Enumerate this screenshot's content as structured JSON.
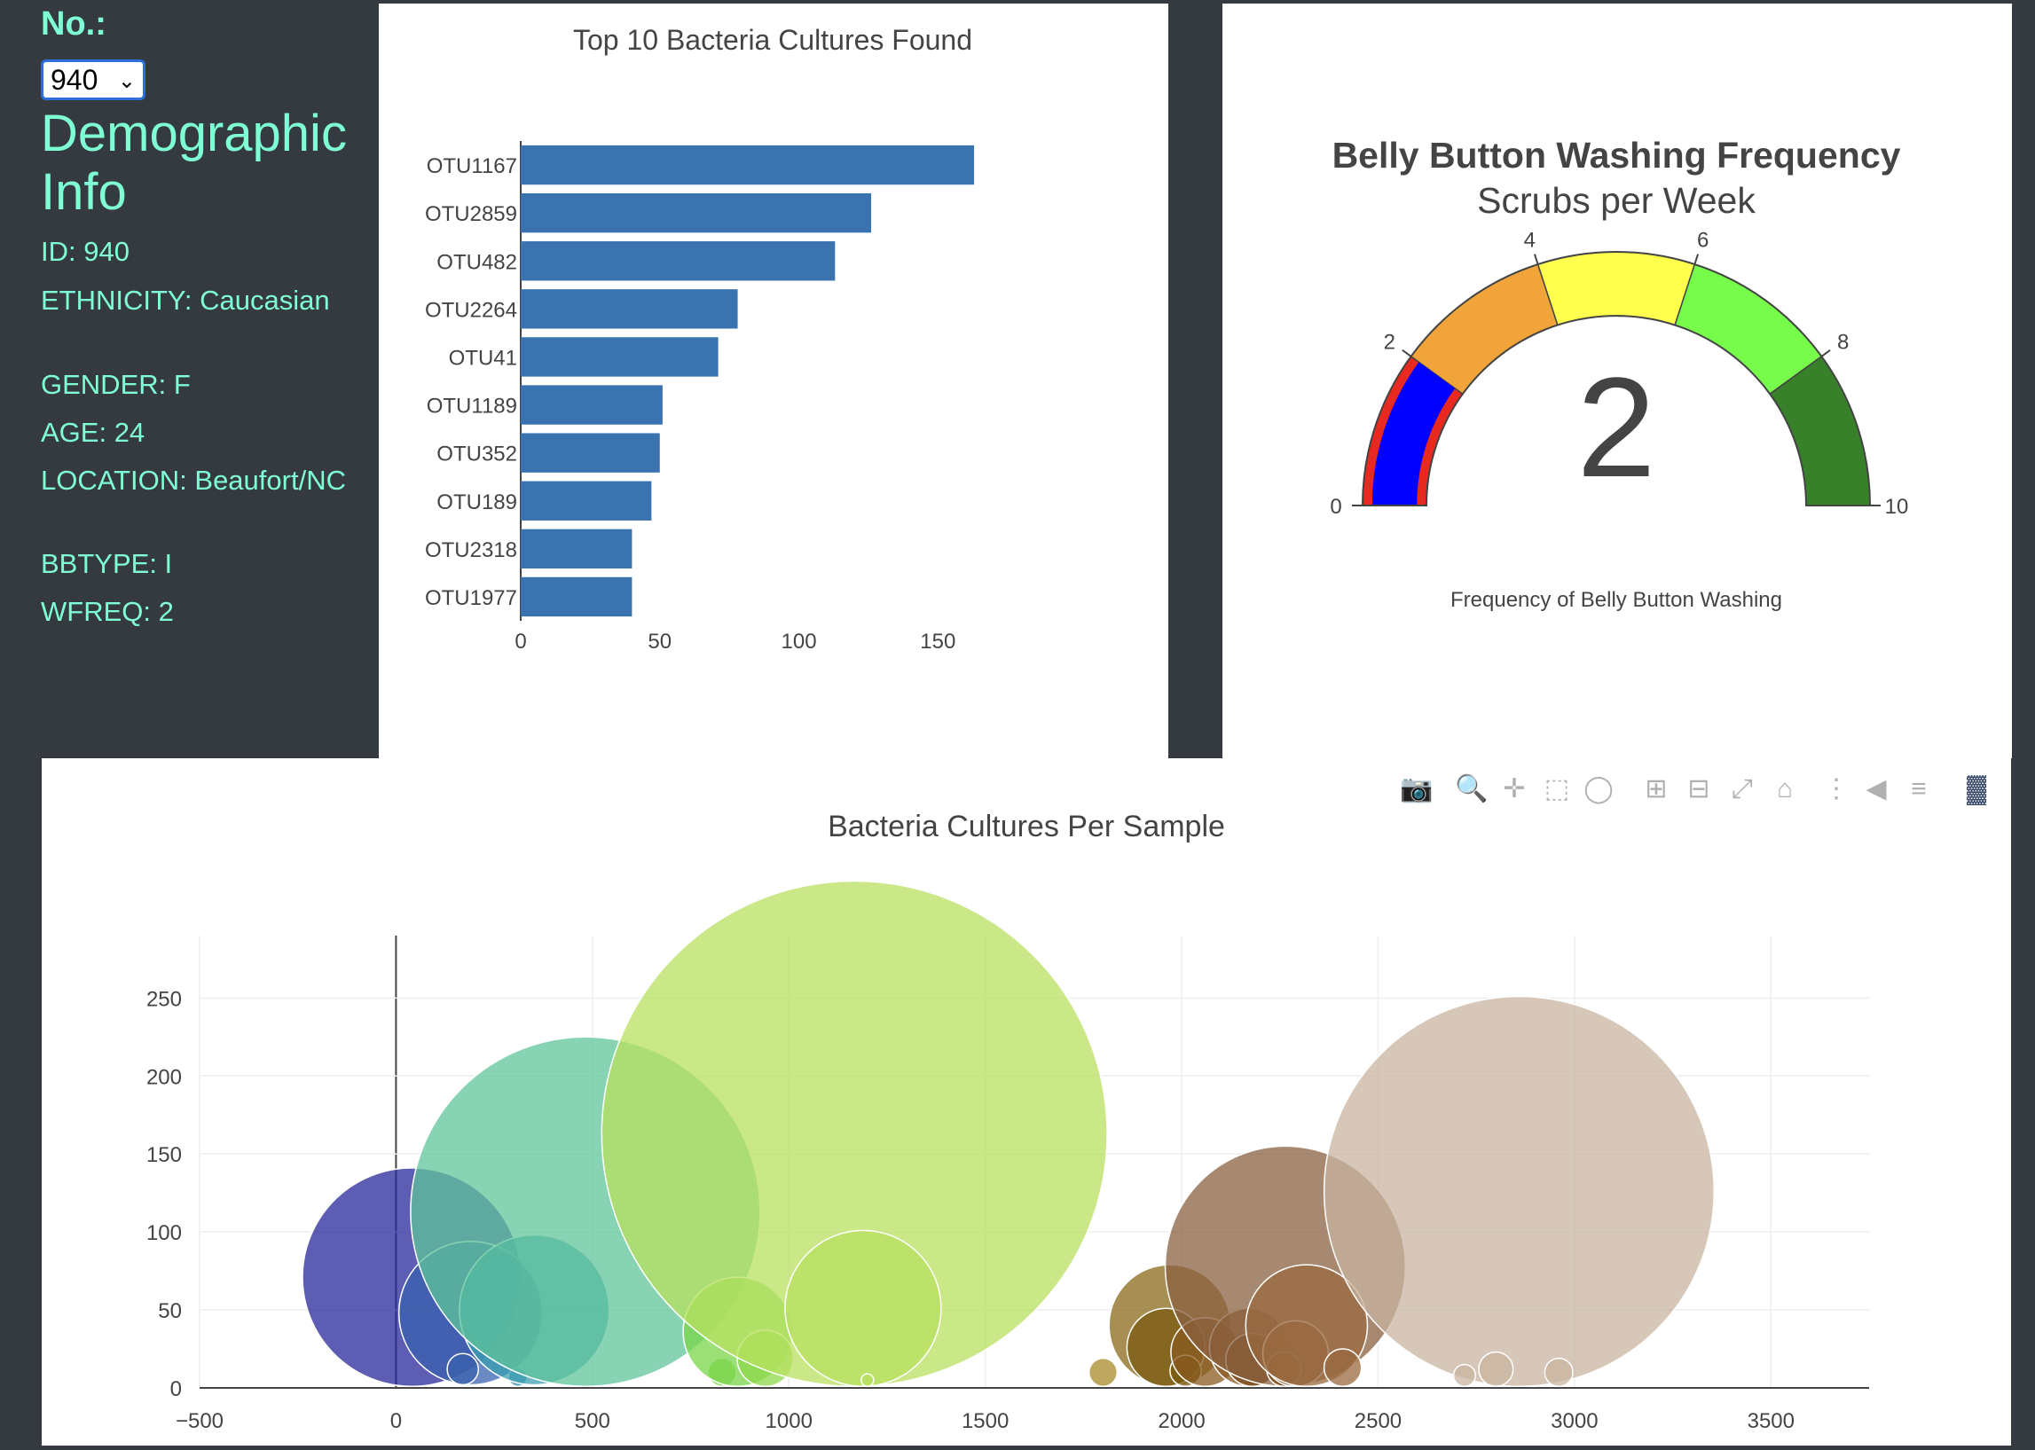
{
  "sidebar": {
    "no_label": "No.:",
    "selected_id": "940",
    "title": "Demographic Info",
    "info": [
      {
        "text": "ID: 940"
      },
      {
        "text": "ETHNICITY: Caucasian"
      },
      {
        "text": "GENDER: F"
      },
      {
        "text": "AGE: 24"
      },
      {
        "text": "LOCATION: Beaufort/NC"
      },
      {
        "text": "BBTYPE: I"
      },
      {
        "text": "WFREQ: 2"
      }
    ]
  },
  "modebar": {
    "icons": [
      "camera-icon",
      "zoom-icon",
      "pan-icon",
      "box-select-icon",
      "lasso-icon",
      "zoom-in-icon",
      "zoom-out-icon",
      "autoscale-icon",
      "reset-axes-icon",
      "spike-lines-icon",
      "hover-closest-icon",
      "hover-compare-icon",
      "plotly-logo-icon"
    ]
  },
  "chart_data": [
    {
      "type": "bar",
      "orientation": "horizontal",
      "title": "Top 10 Bacteria Cultures Found",
      "categories": [
        "OTU1167",
        "OTU2859",
        "OTU482",
        "OTU2264",
        "OTU41",
        "OTU1189",
        "OTU352",
        "OTU189",
        "OTU2318",
        "OTU1977"
      ],
      "values": [
        163,
        126,
        113,
        78,
        71,
        51,
        50,
        47,
        40,
        40
      ],
      "xlim": [
        0,
        170
      ],
      "xticks": [
        0,
        50,
        100,
        150
      ],
      "color": "#3a73b0"
    },
    {
      "type": "gauge",
      "title": "Belly Button Washing Frequency",
      "subtitle": "Scrubs per Week",
      "value": 2,
      "range": [
        0,
        10
      ],
      "ticks": [
        0,
        2,
        4,
        6,
        8,
        10
      ],
      "xlabel": "Frequency of Belly Button Washing",
      "steps": [
        {
          "range": [
            0,
            2
          ],
          "color": "#e8291f"
        },
        {
          "range": [
            2,
            4
          ],
          "color": "#f0a43a"
        },
        {
          "range": [
            4,
            6
          ],
          "color": "#ffff4d"
        },
        {
          "range": [
            6,
            8
          ],
          "color": "#77fc4b"
        },
        {
          "range": [
            8,
            10
          ],
          "color": "#38802a"
        }
      ],
      "bar_color": "#0000ff"
    },
    {
      "type": "scatter",
      "title": "Bacteria Cultures Per Sample",
      "xlim": [
        -500,
        3750
      ],
      "ylim": [
        0,
        290
      ],
      "xticks": [
        -500,
        0,
        500,
        1000,
        1500,
        2000,
        2500,
        3000,
        3500
      ],
      "yticks": [
        0,
        50,
        100,
        150,
        200,
        250
      ],
      "points": [
        {
          "x": 40,
          "y": 71,
          "r": 70,
          "color": "#27279a"
        },
        {
          "x": 190,
          "y": 48,
          "r": 46,
          "color": "#3a62ad"
        },
        {
          "x": 170,
          "y": 12,
          "r": 10,
          "color": "#3a62ad"
        },
        {
          "x": 310,
          "y": 7,
          "r": 6,
          "color": "#3a8ab5"
        },
        {
          "x": 352,
          "y": 50,
          "r": 48,
          "color": "#3a9fb0"
        },
        {
          "x": 482,
          "y": 113,
          "r": 112,
          "color": "#5fc49a"
        },
        {
          "x": 830,
          "y": 10,
          "r": 9,
          "color": "#7ad64a"
        },
        {
          "x": 870,
          "y": 36,
          "r": 35,
          "color": "#7ad64a"
        },
        {
          "x": 940,
          "y": 19,
          "r": 18,
          "color": "#8ed84a"
        },
        {
          "x": 1167,
          "y": 163,
          "r": 162,
          "color": "#b8e060"
        },
        {
          "x": 1189,
          "y": 51,
          "r": 50,
          "color": "#b8e060"
        },
        {
          "x": 1200,
          "y": 5,
          "r": 4,
          "color": "#b8e060"
        },
        {
          "x": 1800,
          "y": 10,
          "r": 9,
          "color": "#a88a2a"
        },
        {
          "x": 1970,
          "y": 40,
          "r": 39,
          "color": "#8a6a1a"
        },
        {
          "x": 1960,
          "y": 26,
          "r": 25,
          "color": "#7a5a10"
        },
        {
          "x": 2010,
          "y": 11,
          "r": 10,
          "color": "#7a5a10"
        },
        {
          "x": 2060,
          "y": 23,
          "r": 22,
          "color": "#8a5a20"
        },
        {
          "x": 2170,
          "y": 26,
          "r": 25,
          "color": "#8a5a25"
        },
        {
          "x": 2180,
          "y": 18,
          "r": 17,
          "color": "#7a4a18"
        },
        {
          "x": 2264,
          "y": 78,
          "r": 77,
          "color": "#8a6040"
        },
        {
          "x": 2260,
          "y": 12,
          "r": 11,
          "color": "#7a4a18"
        },
        {
          "x": 2290,
          "y": 22,
          "r": 21,
          "color": "#9a6a40"
        },
        {
          "x": 2318,
          "y": 40,
          "r": 39,
          "color": "#9a6a40"
        },
        {
          "x": 2410,
          "y": 13,
          "r": 12,
          "color": "#9a6a40"
        },
        {
          "x": 2859,
          "y": 126,
          "r": 125,
          "color": "#c8b4a0"
        },
        {
          "x": 2720,
          "y": 8,
          "r": 7,
          "color": "#c8b4a0"
        },
        {
          "x": 2800,
          "y": 12,
          "r": 11,
          "color": "#c8b4a0"
        },
        {
          "x": 2960,
          "y": 10,
          "r": 9,
          "color": "#c8b4a0"
        }
      ]
    }
  ]
}
